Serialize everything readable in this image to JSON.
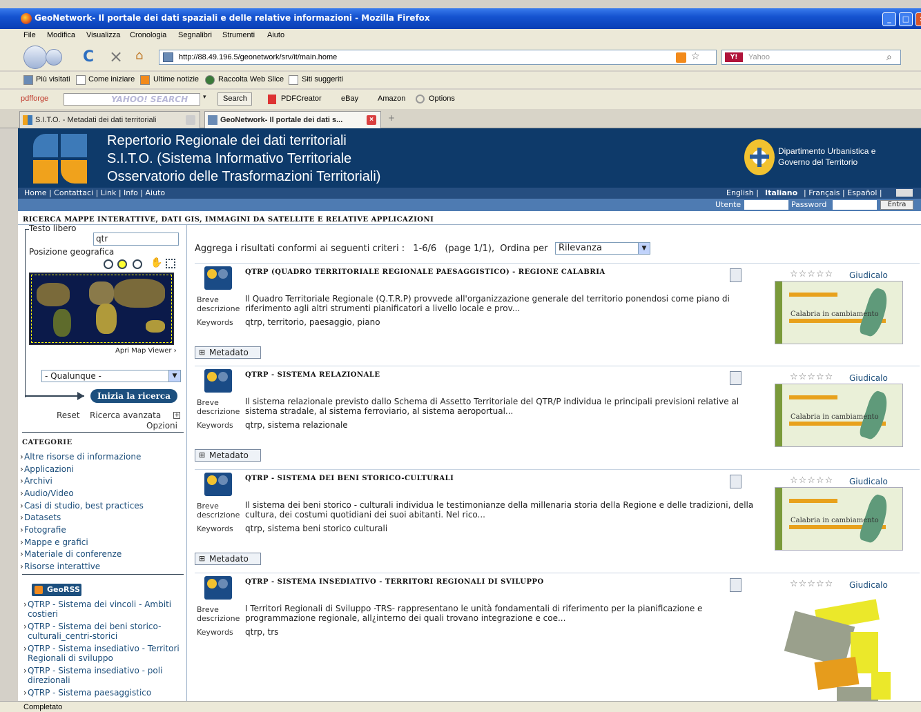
{
  "window": {
    "title": "GeoNetwork- Il portale dei dati spaziali e delle relative informazioni - Mozilla Firefox"
  },
  "menu": [
    "File",
    "Modifica",
    "Visualizza",
    "Cronologia",
    "Segnalibri",
    "Strumenti",
    "Aiuto"
  ],
  "nav": {
    "url": "http://88.49.196.5/geonetwork/srv/it/main.home",
    "search_placeholder": "Yahoo"
  },
  "bookmarks": [
    "Più visitati",
    "Come iniziare",
    "Ultime notizie",
    "Raccolta Web Slice",
    "Siti suggeriti"
  ],
  "toolbar2": {
    "brand": "pdfforge",
    "search_btn": "Search",
    "items": [
      "PDFCreator",
      "eBay",
      "Amazon",
      "Options"
    ]
  },
  "tabs": [
    {
      "label": "S.I.T.O. - Metadati dei dati territoriali",
      "active": false
    },
    {
      "label": "GeoNetwork- Il portale dei dati s...",
      "active": true
    }
  ],
  "banner": {
    "line1": "Repertorio Regionale dei dati territoriali",
    "line2": "S.I.T.O. (Sistema Informativo Territoriale",
    "line3": "Osservatorio delle Trasformazioni Territoriali)",
    "dept1": "Dipartimento Urbanistica e",
    "dept2": "Governo del Territorio"
  },
  "topnav": {
    "links": "Home | Contattaci | Link | Info | Aiuto",
    "lang_en": "English |",
    "lang_it": "Italiano",
    "lang_rest": "| Français | Español |"
  },
  "login": {
    "user_label": "Utente",
    "password_label": "Password",
    "login_btn": "Entra"
  },
  "section_title": "RICERCA MAPPE INTERATTIVE, DATI GIS, IMMAGINI DA SATELLITE E RELATIVE APPLICAZIONI",
  "sidebar": {
    "free_text_label": "Testo libero",
    "free_text_value": "qtr",
    "geo_label": "Posizione geografica",
    "map_viewer": "Apri Map Viewer ›",
    "region_select": "- Qualunque -",
    "search_btn": "Inizia la ricerca",
    "reset": "Reset",
    "advanced": "Ricerca avanzata",
    "options": "Opzioni",
    "categories_title": "CATEGORIE",
    "categories": [
      "Altre risorse di informazione",
      "Applicazioni",
      "Archivi",
      "Audio/Video",
      "Casi di studio, best practices",
      "Datasets",
      "Fotografie",
      "Mappe e grafici",
      "Materiale di conferenze",
      "Risorse interattive"
    ],
    "georss_label": "GeoRSS",
    "rss": [
      "QTRP - Sistema dei vincoli - Ambiti costieri",
      "QTRP - Sistema dei beni storico-culturali_centri-storici",
      "QTRP - Sistema insediativo - Territori Regionali di sviluppo",
      "QTRP - Sistema insediativo - poli direzionali",
      "QTRP - Sistema paesaggistico"
    ]
  },
  "results_header": {
    "prefix": "Aggrega i risultati conformi ai seguenti criteri :",
    "count": "1-6/6",
    "page": "(page 1/1),",
    "sort_label": "Ordina per",
    "sort_value": "Rilevanza"
  },
  "labels": {
    "breve": "Breve",
    "descrizione": "descrizione",
    "keywords": "Keywords",
    "metadato": "Metadato",
    "giudicalo": "Giudicalo",
    "stars": "☆☆☆☆☆",
    "thumb_text": "Calabria in cambiamento"
  },
  "results": [
    {
      "title": "QTRP (QUADRO TERRITORIALE REGIONALE PAESAGGISTICO) - REGIONE CALABRIA",
      "desc": "Il Quadro Territoriale Regionale (Q.T.R.P) provvede all'organizzazione generale del territorio ponendosi come piano di riferimento agli altri strumenti pianificatori a livello locale e prov...",
      "keywords": "qtrp, territorio, paesaggio, piano"
    },
    {
      "title": "QTRP - SISTEMA RELAZIONALE",
      "desc": "Il sistema relazionale previsto dallo Schema di Assetto Territoriale del QTR/P individua le principali previsioni relative al sistema stradale, al sistema ferroviario, al sistema aeroportual...",
      "keywords": "qtrp, sistema relazionale"
    },
    {
      "title": "QTRP - SISTEMA DEI BENI STORICO-CULTURALI",
      "desc": "Il sistema dei beni storico - culturali individua le testimonianze della millenaria storia della Regione e delle tradizioni, della cultura, dei costumi quotidiani dei suoi abitanti. Nel rico...",
      "keywords": "qtrp, sistema beni storico culturali"
    },
    {
      "title": "QTRP - SISTEMA INSEDIATIVO - TERRITORI REGIONALI DI SVILUPPO",
      "desc": "I Territori Regionali di Sviluppo -TRS- rappresentano le unità fondamentali di riferimento per la pianificazione e programmazione regionale, all¿interno dei quali trovano integrazione e coe...",
      "keywords": "qtrp, trs"
    }
  ],
  "status": "Completato"
}
